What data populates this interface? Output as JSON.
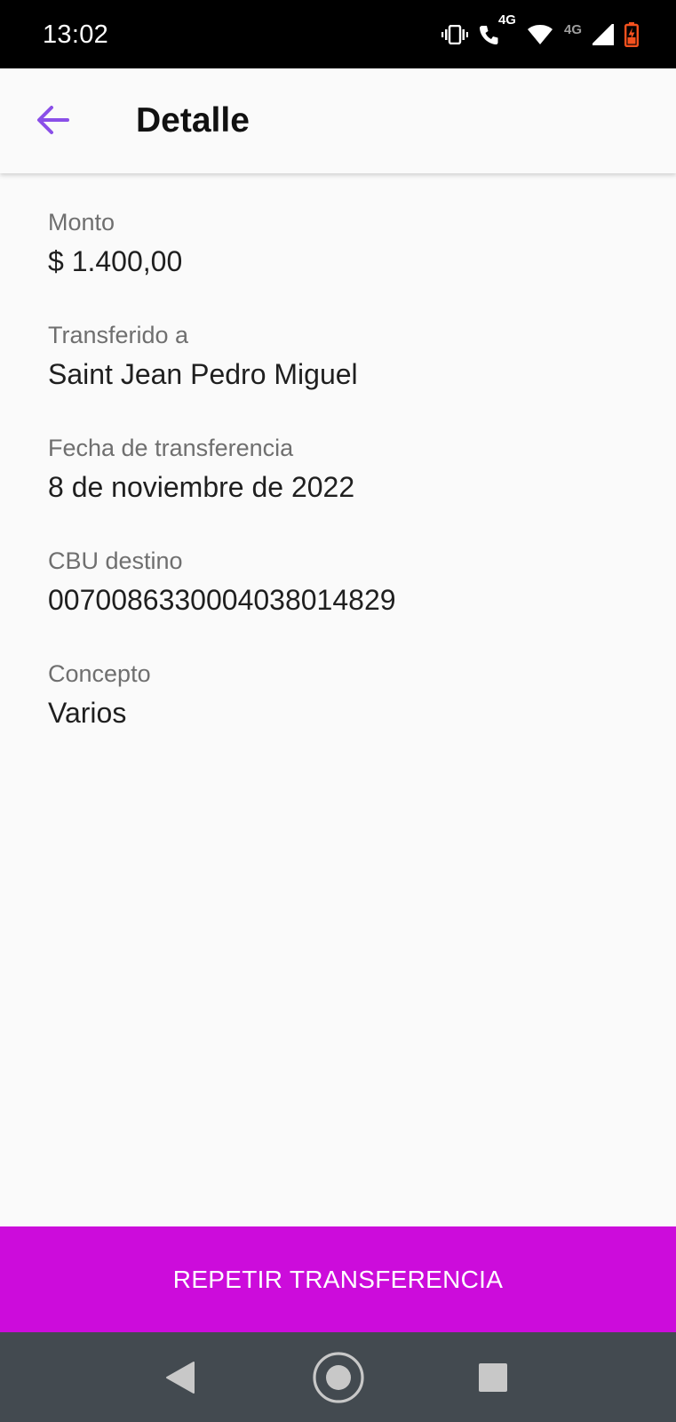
{
  "status_bar": {
    "time": "13:02",
    "call_network_label": "4G",
    "data_network_label": "4G",
    "icons": [
      "vibrate-icon",
      "wifi-call-icon",
      "wifi-icon",
      "signal-icon",
      "battery-charging-icon"
    ]
  },
  "app_bar": {
    "back_icon": "arrow-left-icon",
    "title": "Detalle"
  },
  "details": [
    {
      "label": "Monto",
      "value": "$ 1.400,00"
    },
    {
      "label": "Transferido a",
      "value": "Saint Jean Pedro Miguel"
    },
    {
      "label": "Fecha de transferencia",
      "value": "8 de noviembre de 2022"
    },
    {
      "label": "CBU destino",
      "value": "0070086330004038014829"
    },
    {
      "label": "Concepto",
      "value": "Varios"
    }
  ],
  "primary_action": {
    "label": "REPETIR TRANSFERENCIA"
  },
  "nav_bar": {
    "icons": [
      "nav-back-icon",
      "nav-home-icon",
      "nav-recents-icon"
    ]
  },
  "colors": {
    "accent": "#8a4fe8",
    "button": "#cc0cdb",
    "battery": "#f4511e",
    "status_bar": "#000000",
    "nav_bar": "#434a50",
    "background": "#fafafa"
  }
}
